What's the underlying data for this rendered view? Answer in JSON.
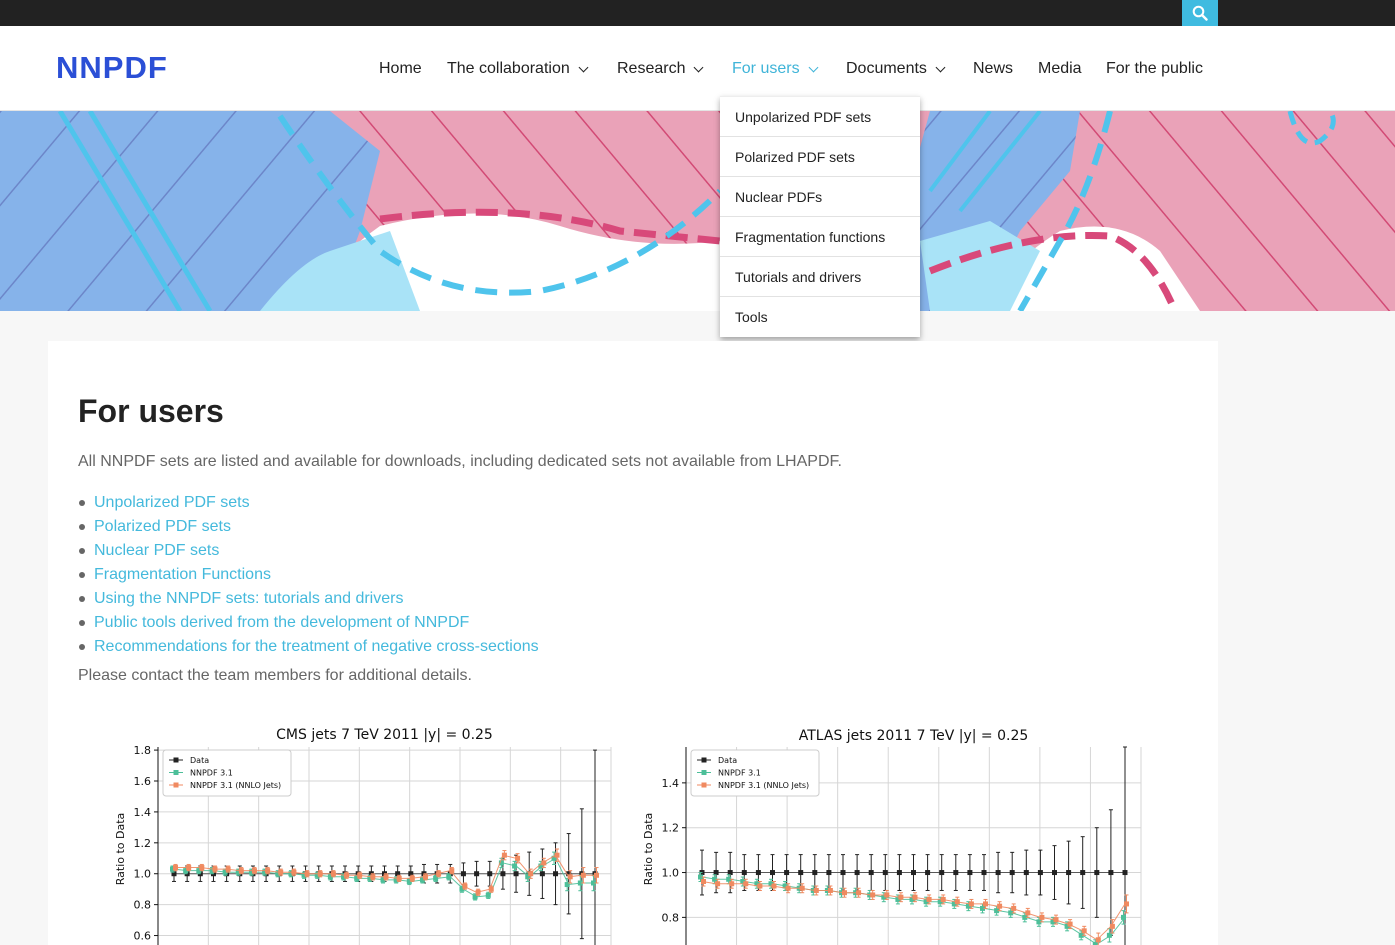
{
  "header": {
    "logo_text": "NNPDF",
    "search_icon": "search-icon",
    "nav": [
      {
        "label": "Home"
      },
      {
        "label": "The collaboration",
        "has_menu": true
      },
      {
        "label": "Research",
        "has_menu": true
      },
      {
        "label": "For users",
        "has_menu": true,
        "active": true
      },
      {
        "label": "Documents",
        "has_menu": true
      },
      {
        "label": "News"
      },
      {
        "label": "Media"
      },
      {
        "label": "For the public"
      }
    ],
    "colors": {
      "accent": "#3fbbe0",
      "topbar": "#222222",
      "link": "#44b9dc"
    }
  },
  "dropdown": {
    "items": [
      "Unpolarized PDF sets",
      "Polarized PDF sets",
      "Nuclear PDFs",
      "Fragmentation functions",
      "Tutorials and drivers",
      "Tools"
    ]
  },
  "main": {
    "title": "For users",
    "intro": "All NNPDF sets are listed and available for downloads, including dedicated sets not available from LHAPDF.",
    "links": [
      "Unpolarized PDF sets",
      "Polarized PDF sets",
      "Nuclear PDF sets",
      "Fragmentation Functions",
      "Using the NNPDF sets: tutorials and drivers",
      "Public tools derived from the development of NNPDF",
      "Recommendations for the treatment of negative cross-sections"
    ],
    "outro": "Please contact the team members for additional details."
  },
  "chart_data": [
    {
      "type": "scatter",
      "title": "CMS jets 7 TeV 2011 |y| = 0.25",
      "ylabel": "Ratio to Data",
      "ylim": [
        0.5,
        1.82
      ],
      "yticks": [
        "0.6",
        "0.8",
        "1.0",
        "1.2",
        "1.4",
        "1.6",
        "1.8"
      ],
      "legend": [
        "Data",
        "NNPDF 3.1",
        "NNPDF 3.1 (NNLO Jets)"
      ],
      "legend_position": "top-left",
      "grid": true,
      "series": [
        {
          "name": "Data",
          "color": "#222222",
          "x": [
            1,
            2,
            3,
            4,
            5,
            6,
            7,
            8,
            9,
            10,
            11,
            12,
            13,
            14,
            15,
            16,
            17,
            18,
            19,
            20,
            21,
            22,
            23,
            24,
            25,
            26,
            27,
            28,
            29,
            30,
            31,
            32,
            33
          ],
          "y": [
            1,
            1,
            1,
            1,
            1,
            1,
            1,
            1,
            1,
            1,
            1,
            1,
            1,
            1,
            1,
            1,
            1,
            1,
            1,
            1,
            1,
            1,
            1,
            1,
            1,
            1,
            1,
            1,
            1,
            1,
            1,
            1,
            1
          ],
          "err": [
            0.05,
            0.05,
            0.05,
            0.05,
            0.05,
            0.05,
            0.05,
            0.05,
            0.05,
            0.05,
            0.05,
            0.05,
            0.05,
            0.05,
            0.05,
            0.05,
            0.05,
            0.05,
            0.05,
            0.06,
            0.06,
            0.06,
            0.07,
            0.08,
            0.08,
            0.1,
            0.12,
            0.14,
            0.16,
            0.2,
            0.26,
            0.42,
            0.8
          ]
        },
        {
          "name": "NNPDF 3.1",
          "color": "#4dbf99",
          "x": [
            1,
            2,
            3,
            4,
            5,
            6,
            7,
            8,
            9,
            10,
            11,
            12,
            13,
            14,
            15,
            16,
            17,
            18,
            19,
            20,
            21,
            22,
            23,
            24,
            25,
            26,
            27,
            28,
            29,
            30,
            31,
            32,
            33
          ],
          "y": [
            1.03,
            1.02,
            1.02,
            1.02,
            1.01,
            1.01,
            1.01,
            1.01,
            1.0,
            1.0,
            0.99,
            0.99,
            0.98,
            0.98,
            0.97,
            0.97,
            0.96,
            0.96,
            0.95,
            0.96,
            0.97,
            0.98,
            0.9,
            0.85,
            0.86,
            1.07,
            1.05,
            0.98,
            1.05,
            1.1,
            0.93,
            0.94,
            0.94
          ],
          "err": [
            0.02,
            0.02,
            0.02,
            0.02,
            0.02,
            0.02,
            0.02,
            0.02,
            0.02,
            0.02,
            0.02,
            0.02,
            0.02,
            0.02,
            0.02,
            0.02,
            0.02,
            0.02,
            0.02,
            0.02,
            0.02,
            0.02,
            0.02,
            0.02,
            0.02,
            0.03,
            0.03,
            0.03,
            0.03,
            0.04,
            0.04,
            0.05,
            0.05
          ]
        },
        {
          "name": "NNPDF 3.1 (NNLO Jets)",
          "color": "#f08a60",
          "x": [
            1,
            2,
            3,
            4,
            5,
            6,
            7,
            8,
            9,
            10,
            11,
            12,
            13,
            14,
            15,
            16,
            17,
            18,
            19,
            20,
            21,
            22,
            23,
            24,
            25,
            26,
            27,
            28,
            29,
            30,
            31,
            32,
            33
          ],
          "y": [
            1.04,
            1.04,
            1.04,
            1.03,
            1.03,
            1.02,
            1.02,
            1.02,
            1.01,
            1.01,
            1.0,
            1.0,
            1.0,
            0.99,
            0.99,
            0.98,
            0.98,
            0.97,
            0.97,
            0.98,
            1.0,
            1.02,
            0.92,
            0.88,
            0.9,
            1.12,
            1.1,
            1.0,
            1.07,
            1.12,
            0.98,
            0.99,
            0.99
          ],
          "err": [
            0.02,
            0.02,
            0.02,
            0.02,
            0.02,
            0.02,
            0.02,
            0.02,
            0.02,
            0.02,
            0.02,
            0.02,
            0.02,
            0.02,
            0.02,
            0.02,
            0.02,
            0.02,
            0.02,
            0.02,
            0.02,
            0.02,
            0.02,
            0.02,
            0.02,
            0.03,
            0.03,
            0.03,
            0.03,
            0.04,
            0.04,
            0.05,
            0.05
          ]
        }
      ]
    },
    {
      "type": "scatter",
      "title": "ATLAS jets 2011 7 TeV |y| = 0.25",
      "ylabel": "Ratio to Data",
      "ylim": [
        0.65,
        1.56
      ],
      "yticks": [
        "0.8",
        "1.0",
        "1.2",
        "1.4"
      ],
      "legend": [
        "Data",
        "NNPDF 3.1",
        "NNPDF 3.1 (NNLO Jets)"
      ],
      "legend_position": "top-left",
      "grid": true,
      "series": [
        {
          "name": "Data",
          "color": "#222222",
          "x": [
            1,
            2,
            3,
            4,
            5,
            6,
            7,
            8,
            9,
            10,
            11,
            12,
            13,
            14,
            15,
            16,
            17,
            18,
            19,
            20,
            21,
            22,
            23,
            24,
            25,
            26,
            27,
            28,
            29,
            30,
            31
          ],
          "y": [
            1,
            1,
            1,
            1,
            1,
            1,
            1,
            1,
            1,
            1,
            1,
            1,
            1,
            1,
            1,
            1,
            1,
            1,
            1,
            1,
            1,
            1,
            1,
            1,
            1,
            1,
            1,
            1,
            1,
            1,
            1
          ],
          "err": [
            0.1,
            0.09,
            0.09,
            0.08,
            0.08,
            0.08,
            0.08,
            0.08,
            0.08,
            0.08,
            0.08,
            0.08,
            0.08,
            0.08,
            0.08,
            0.08,
            0.08,
            0.08,
            0.08,
            0.08,
            0.08,
            0.09,
            0.09,
            0.1,
            0.1,
            0.12,
            0.14,
            0.16,
            0.2,
            0.28,
            0.6
          ]
        },
        {
          "name": "NNPDF 3.1",
          "color": "#4dbf99",
          "x": [
            1,
            2,
            3,
            4,
            5,
            6,
            7,
            8,
            9,
            10,
            11,
            12,
            13,
            14,
            15,
            16,
            17,
            18,
            19,
            20,
            21,
            22,
            23,
            24,
            25,
            26,
            27,
            28,
            29,
            30,
            31
          ],
          "y": [
            0.98,
            0.97,
            0.97,
            0.96,
            0.95,
            0.95,
            0.94,
            0.93,
            0.92,
            0.92,
            0.91,
            0.91,
            0.9,
            0.89,
            0.88,
            0.88,
            0.87,
            0.87,
            0.86,
            0.85,
            0.84,
            0.83,
            0.82,
            0.8,
            0.78,
            0.78,
            0.76,
            0.72,
            0.68,
            0.72,
            0.8
          ],
          "err": [
            0.02,
            0.02,
            0.02,
            0.02,
            0.02,
            0.02,
            0.02,
            0.02,
            0.02,
            0.02,
            0.02,
            0.02,
            0.02,
            0.02,
            0.02,
            0.02,
            0.02,
            0.02,
            0.02,
            0.02,
            0.02,
            0.02,
            0.02,
            0.02,
            0.02,
            0.02,
            0.02,
            0.02,
            0.02,
            0.03,
            0.03
          ]
        },
        {
          "name": "NNPDF 3.1 (NNLO Jets)",
          "color": "#f08a60",
          "x": [
            1,
            2,
            3,
            4,
            5,
            6,
            7,
            8,
            9,
            10,
            11,
            12,
            13,
            14,
            15,
            16,
            17,
            18,
            19,
            20,
            21,
            22,
            23,
            24,
            25,
            26,
            27,
            28,
            29,
            30,
            31
          ],
          "y": [
            0.96,
            0.95,
            0.95,
            0.95,
            0.94,
            0.94,
            0.93,
            0.93,
            0.92,
            0.92,
            0.91,
            0.91,
            0.9,
            0.9,
            0.89,
            0.89,
            0.88,
            0.88,
            0.87,
            0.86,
            0.86,
            0.85,
            0.84,
            0.82,
            0.8,
            0.79,
            0.77,
            0.74,
            0.7,
            0.76,
            0.86
          ],
          "err": [
            0.02,
            0.02,
            0.02,
            0.02,
            0.02,
            0.02,
            0.02,
            0.02,
            0.02,
            0.02,
            0.02,
            0.02,
            0.02,
            0.02,
            0.02,
            0.02,
            0.02,
            0.02,
            0.02,
            0.02,
            0.02,
            0.02,
            0.02,
            0.02,
            0.02,
            0.02,
            0.02,
            0.02,
            0.03,
            0.03,
            0.04
          ]
        }
      ]
    }
  ]
}
